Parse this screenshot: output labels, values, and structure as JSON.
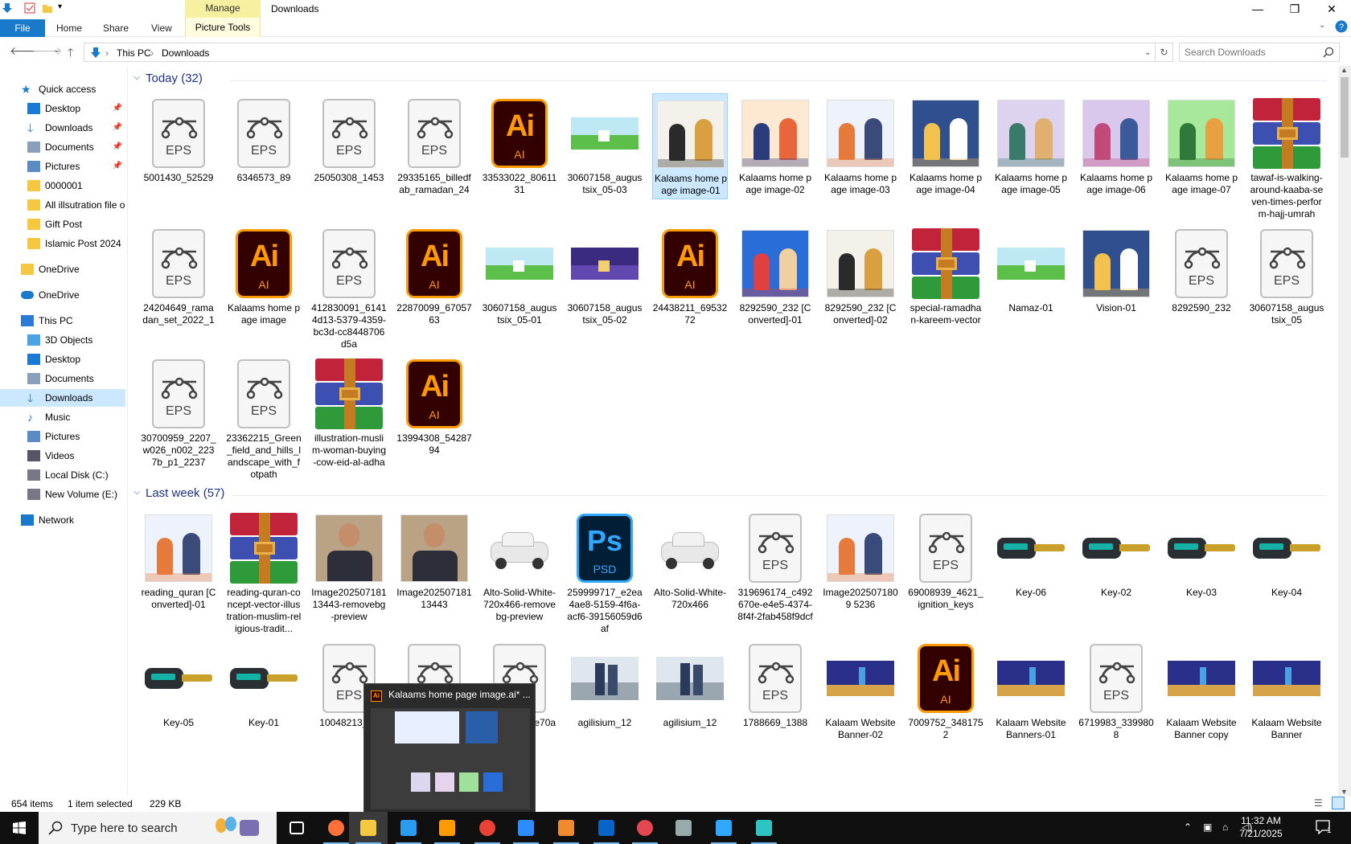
{
  "window": {
    "title": "Downloads",
    "manage_label": "Manage",
    "controls": {
      "minimize": "—",
      "maximize": "❐",
      "close": "✕"
    }
  },
  "ribbon": {
    "file": "File",
    "tabs": [
      "Home",
      "Share",
      "View"
    ],
    "picture_tools": "Picture Tools"
  },
  "address": {
    "crumbs": [
      "This PC",
      "Downloads"
    ],
    "search_placeholder": "Search Downloads"
  },
  "nav": {
    "items": [
      {
        "label": "Quick access",
        "icon": "star-icon"
      },
      {
        "label": "Desktop",
        "icon": "desktop-icon",
        "pinned": true
      },
      {
        "label": "Downloads",
        "icon": "download-icon",
        "pinned": true
      },
      {
        "label": "Documents",
        "icon": "documents-icon",
        "pinned": true
      },
      {
        "label": "Pictures",
        "icon": "pictures-icon",
        "pinned": true
      },
      {
        "label": "0000001",
        "icon": "folder-icon"
      },
      {
        "label": "All illsutration file o",
        "icon": "folder-icon"
      },
      {
        "label": "Gift Post",
        "icon": "folder-icon"
      },
      {
        "label": "Islamic Post 2024",
        "icon": "folder-icon"
      },
      {
        "label": "OneDrive",
        "icon": "folder-icon"
      },
      {
        "label": "OneDrive",
        "icon": "cloud-icon"
      },
      {
        "label": "This PC",
        "icon": "computer-icon"
      },
      {
        "label": "3D Objects",
        "icon": "cube-icon"
      },
      {
        "label": "Desktop",
        "icon": "desktop-icon"
      },
      {
        "label": "Documents",
        "icon": "documents-icon"
      },
      {
        "label": "Downloads",
        "icon": "download-icon",
        "selected": true
      },
      {
        "label": "Music",
        "icon": "music-icon"
      },
      {
        "label": "Pictures",
        "icon": "pictures-icon"
      },
      {
        "label": "Videos",
        "icon": "video-icon"
      },
      {
        "label": "Local Disk (C:)",
        "icon": "drive-icon"
      },
      {
        "label": "New Volume (E:)",
        "icon": "drive-icon"
      },
      {
        "label": "Network",
        "icon": "network-icon"
      }
    ]
  },
  "groups": [
    {
      "title": "Today (32)"
    },
    {
      "title": "Last week (57)"
    }
  ],
  "files_today": [
    {
      "name": "5001430_52529",
      "type": "eps"
    },
    {
      "name": "6346573_89",
      "type": "eps"
    },
    {
      "name": "25050308_1453",
      "type": "eps"
    },
    {
      "name": "29335165_billedfab_ramadan_24",
      "type": "eps"
    },
    {
      "name": "33533022_8061131",
      "type": "ai"
    },
    {
      "name": "30607158_augustsix_05-03",
      "type": "landscape"
    },
    {
      "name": "Kalaams home page image-01",
      "type": "img",
      "selected": true
    },
    {
      "name": "Kalaams home page image-02",
      "type": "img"
    },
    {
      "name": "Kalaams home page image-03",
      "type": "img"
    },
    {
      "name": "Kalaams home page image-04",
      "type": "img"
    },
    {
      "name": "Kalaams home page image-05",
      "type": "img"
    },
    {
      "name": "Kalaams home page image-06",
      "type": "img"
    },
    {
      "name": "Kalaams home page image-07",
      "type": "img"
    },
    {
      "name": "tawaf-is-walking-around-kaaba-seven-times-perform-hajj-umrah",
      "type": "rar"
    },
    {
      "name": "24204649_ramadan_set_2022_1",
      "type": "eps"
    },
    {
      "name": "Kalaams home page image",
      "type": "ai"
    },
    {
      "name": "412830091_61414d13-5379-4359-bc3d-cc8448706d5a",
      "type": "eps"
    },
    {
      "name": "22870099_6705763",
      "type": "ai"
    },
    {
      "name": "30607158_augustsix_05-01",
      "type": "landscape"
    },
    {
      "name": "30607158_augustsix_05-02",
      "type": "night"
    },
    {
      "name": "24438211_6953272",
      "type": "ai"
    },
    {
      "name": "8292590_232 [Converted]-01",
      "type": "img"
    },
    {
      "name": "8292590_232 [Converted]-02",
      "type": "img"
    },
    {
      "name": "special-ramadhan-kareem-vector",
      "type": "rar"
    },
    {
      "name": "Namaz-01",
      "type": "landscape"
    },
    {
      "name": "Vision-01",
      "type": "img"
    },
    {
      "name": "8292590_232",
      "type": "eps"
    },
    {
      "name": "30607158_augustsix_05",
      "type": "eps"
    },
    {
      "name": "30700959_2207_w026_n002_2237b_p1_2237",
      "type": "eps"
    },
    {
      "name": "23362215_Green_field_and_hills_landscape_with_fotpath",
      "type": "eps"
    },
    {
      "name": "illustration-muslim-woman-buying-cow-eid-al-adha",
      "type": "rar"
    },
    {
      "name": "13994308_5428794",
      "type": "ai"
    }
  ],
  "files_lastweek": [
    {
      "name": "reading_quran [Converted]-01",
      "type": "img"
    },
    {
      "name": "reading-quran-concept-vector-illustration-muslim-religious-tradit...",
      "type": "rar"
    },
    {
      "name": "Image20250718113443-removebg-preview",
      "type": "portrait"
    },
    {
      "name": "Image20250718113443",
      "type": "portrait"
    },
    {
      "name": "Alto-Solid-White-720x466-removebg-preview",
      "type": "car"
    },
    {
      "name": "259999717_e2ea4ae8-5159-4f6a-acf6-39156059d6af",
      "type": "psd"
    },
    {
      "name": "Alto-Solid-White-720x466",
      "type": "car"
    },
    {
      "name": "319696174_c492670e-e4e5-4374-8f4f-2fab458f9dcf",
      "type": "eps"
    },
    {
      "name": "Image2025071809 5236",
      "type": "img"
    },
    {
      "name": "69008939_4621_ignition_keys",
      "type": "eps"
    },
    {
      "name": "Key-06",
      "type": "key"
    },
    {
      "name": "Key-02",
      "type": "key"
    },
    {
      "name": "Key-03",
      "type": "key"
    },
    {
      "name": "Key-04",
      "type": "key"
    },
    {
      "name": "Key-05",
      "type": "key"
    },
    {
      "name": "Key-01",
      "type": "key"
    },
    {
      "name": "10048213_31",
      "type": "eps"
    },
    {
      "name": "",
      "type": "eps"
    },
    {
      "name": "1606c349-9e70a5",
      "type": "eps"
    },
    {
      "name": "agilisium_12",
      "type": "group"
    },
    {
      "name": "agilisium_12",
      "type": "group"
    },
    {
      "name": "1788669_1388",
      "type": "eps"
    },
    {
      "name": "Kalaam Website Banner-02",
      "type": "banner"
    },
    {
      "name": "7009752_3481752",
      "type": "ai"
    },
    {
      "name": "Kalaam Website Banners-01",
      "type": "banner"
    },
    {
      "name": "6719983_3399808",
      "type": "eps"
    },
    {
      "name": "Kalaam Website Banner copy",
      "type": "banner"
    },
    {
      "name": "Kalaam Website Banner",
      "type": "banner"
    }
  ],
  "status": {
    "count": "654 items",
    "selection": "1 item selected",
    "size": "229 KB"
  },
  "preview": {
    "title": "Kalaams home page image.ai* ..."
  },
  "taskbar": {
    "search_placeholder": "Type here to search",
    "time": "11:32 AM",
    "date": "7/21/2025",
    "notification_count": "1",
    "apps": [
      "task-view-icon",
      "firefox-icon",
      "file-explorer-icon",
      "vscode-icon",
      "illustrator-icon",
      "chrome-icon",
      "zoom-icon",
      "app-icon",
      "outlook-icon",
      "creative-cloud-icon",
      "pen-icon",
      "photoshop-icon",
      "app2-icon"
    ]
  },
  "colors": {
    "accent": "#1979ca",
    "selection": "#cce8ff",
    "ai_orange": "#ff9a00",
    "ps_blue": "#31a8ff"
  }
}
